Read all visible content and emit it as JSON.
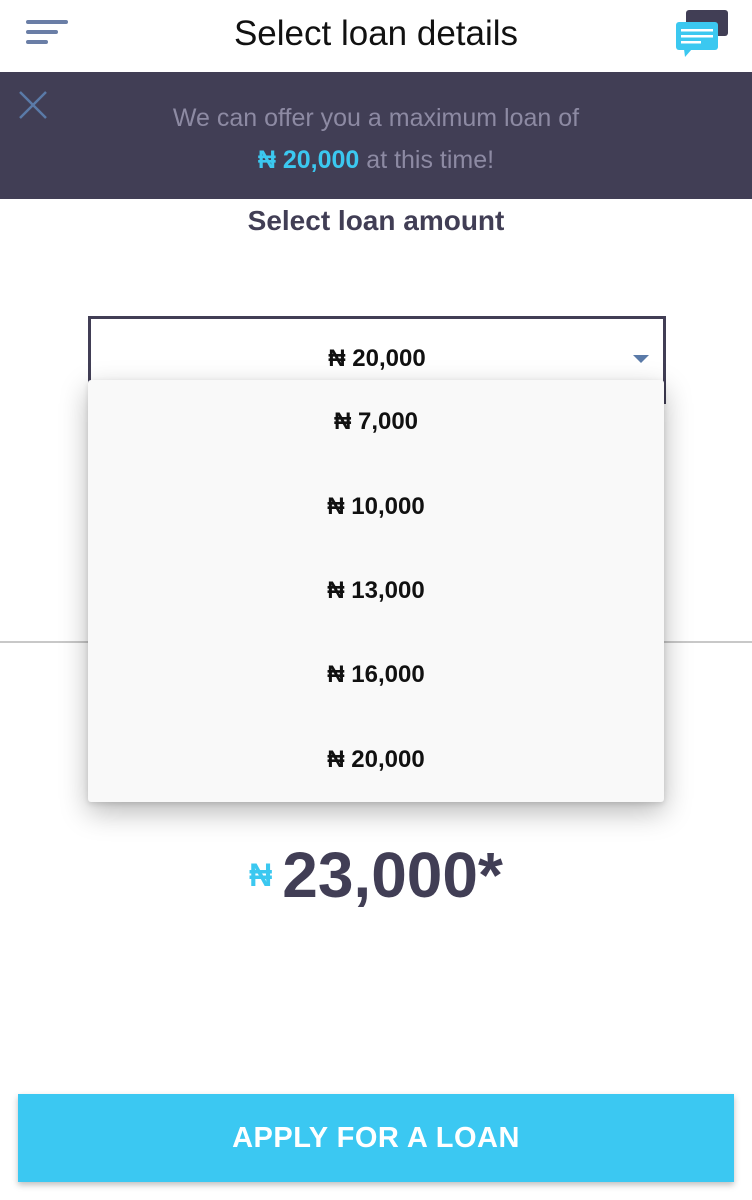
{
  "header": {
    "title": "Select loan details",
    "menu_icon": "menu-icon",
    "chat_icon": "chat-icon"
  },
  "banner": {
    "line1": "We can offer you a maximum loan of",
    "amount": "₦ 20,000",
    "line2_suffix": " at this time!"
  },
  "loan_amount": {
    "section_title": "Select loan amount",
    "selected": "₦ 20,000",
    "options": [
      "₦ 7,000",
      "₦ 10,000",
      "₦ 13,000",
      "₦ 16,000",
      "₦ 20,000"
    ]
  },
  "total": {
    "currency": "₦",
    "amount": "23,000*"
  },
  "apply_label": "APPLY FOR A LOAN",
  "colors": {
    "accent": "#3bc8f0",
    "banner_bg": "#413e55",
    "banner_text": "#8d8aa3",
    "dark_text": "#413e55"
  }
}
